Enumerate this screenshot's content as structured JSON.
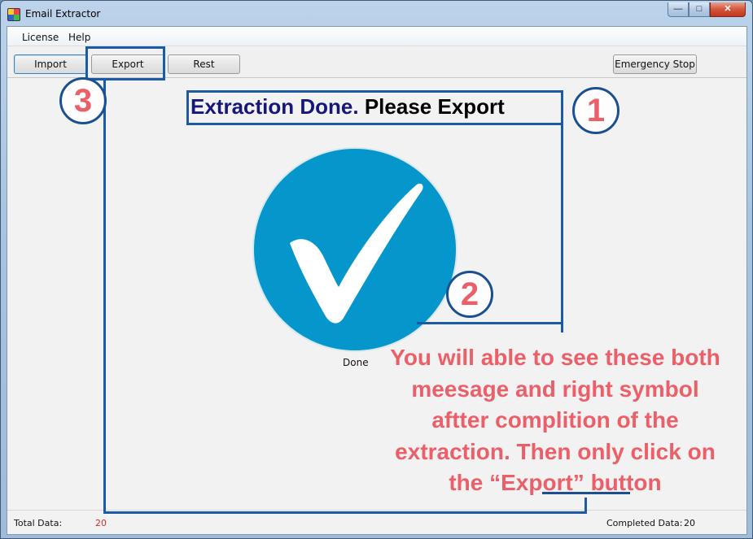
{
  "window": {
    "title": "Email Extractor",
    "controls": {
      "minimize": "—",
      "maximize": "□",
      "close": "✕"
    }
  },
  "menu": {
    "license": "License",
    "help": "Help"
  },
  "toolbar": {
    "import_label": "Import",
    "export_label": "Export",
    "rest_label": "Rest",
    "emergency_stop_label": "Emergency Stop"
  },
  "main": {
    "headline_part1": "Extraction Done.",
    "headline_part2": "Please Export",
    "status_icon": "checkmark-icon",
    "done_label": "Done"
  },
  "status": {
    "total_label": "Total Data:",
    "total_value": "20",
    "completed_label": "Completed Data:",
    "completed_value": "20"
  },
  "annotations": {
    "marker_1": "1",
    "marker_2": "2",
    "marker_3": "3",
    "note_text": "You will able to see these both meesage and right symbol aftter complition of the extraction. Then only click on the “Export” button"
  },
  "colors": {
    "accent_blue": "#0596cb",
    "annotation_red": "#ec5f69",
    "annotation_line": "#1a5aa6",
    "headline_blue": "#17177a",
    "total_value_red": "#d92b2b"
  }
}
